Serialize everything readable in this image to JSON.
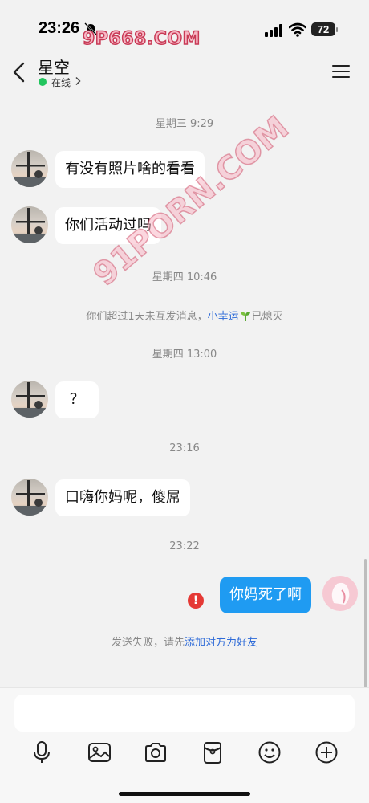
{
  "status_bar": {
    "time": "23:26",
    "battery": "72",
    "watermark": "9P668.COM"
  },
  "header": {
    "contact_name": "星空",
    "status": "在线"
  },
  "watermark_diagonal": "91PORN.COM",
  "chat": {
    "ts1": "星期三 9:29",
    "msg1": "有没有照片啥的看看",
    "msg2": "你们活动过吗",
    "ts2": "星期四 10:46",
    "system_notice": {
      "prefix": "你们超过1天未互发消息，",
      "link": "小幸运",
      "suffix": "已熄灭"
    },
    "ts3": "星期四 13:00",
    "msg3": "？",
    "ts4": "23:16",
    "msg4": "口嗨你妈呢，傻屌",
    "ts5": "23:22",
    "my_msg": "你妈死了啊",
    "send_failed": {
      "prefix": "发送失败，请先",
      "link": "添加对方为好友"
    }
  },
  "input": {
    "placeholder": ""
  },
  "toolbar": [
    "mic-icon",
    "image-icon",
    "camera-icon",
    "red-packet-icon",
    "emoji-icon",
    "plus-icon"
  ]
}
